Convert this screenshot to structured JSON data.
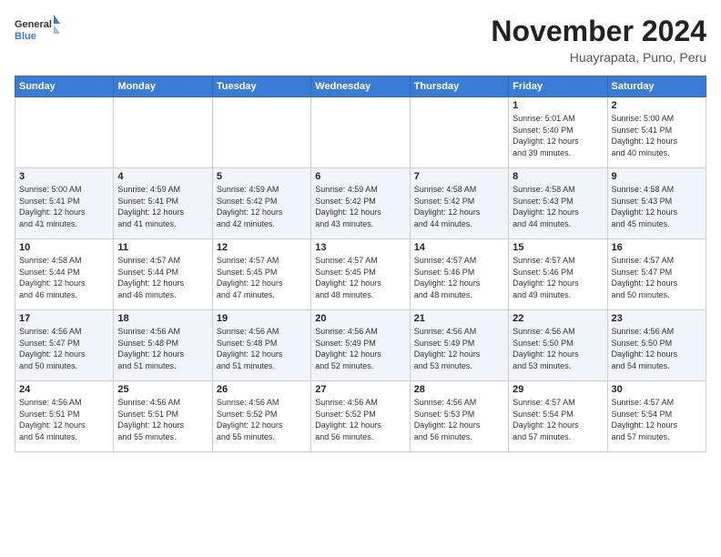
{
  "logo": {
    "general": "General",
    "blue": "Blue"
  },
  "header": {
    "month": "November 2024",
    "location": "Huayrapata, Puno, Peru"
  },
  "weekdays": [
    "Sunday",
    "Monday",
    "Tuesday",
    "Wednesday",
    "Thursday",
    "Friday",
    "Saturday"
  ],
  "weeks": [
    [
      {
        "day": "",
        "info": ""
      },
      {
        "day": "",
        "info": ""
      },
      {
        "day": "",
        "info": ""
      },
      {
        "day": "",
        "info": ""
      },
      {
        "day": "",
        "info": ""
      },
      {
        "day": "1",
        "info": "Sunrise: 5:01 AM\nSunset: 5:40 PM\nDaylight: 12 hours\nand 39 minutes."
      },
      {
        "day": "2",
        "info": "Sunrise: 5:00 AM\nSunset: 5:41 PM\nDaylight: 12 hours\nand 40 minutes."
      }
    ],
    [
      {
        "day": "3",
        "info": "Sunrise: 5:00 AM\nSunset: 5:41 PM\nDaylight: 12 hours\nand 41 minutes."
      },
      {
        "day": "4",
        "info": "Sunrise: 4:59 AM\nSunset: 5:41 PM\nDaylight: 12 hours\nand 41 minutes."
      },
      {
        "day": "5",
        "info": "Sunrise: 4:59 AM\nSunset: 5:42 PM\nDaylight: 12 hours\nand 42 minutes."
      },
      {
        "day": "6",
        "info": "Sunrise: 4:59 AM\nSunset: 5:42 PM\nDaylight: 12 hours\nand 43 minutes."
      },
      {
        "day": "7",
        "info": "Sunrise: 4:58 AM\nSunset: 5:42 PM\nDaylight: 12 hours\nand 44 minutes."
      },
      {
        "day": "8",
        "info": "Sunrise: 4:58 AM\nSunset: 5:43 PM\nDaylight: 12 hours\nand 44 minutes."
      },
      {
        "day": "9",
        "info": "Sunrise: 4:58 AM\nSunset: 5:43 PM\nDaylight: 12 hours\nand 45 minutes."
      }
    ],
    [
      {
        "day": "10",
        "info": "Sunrise: 4:58 AM\nSunset: 5:44 PM\nDaylight: 12 hours\nand 46 minutes."
      },
      {
        "day": "11",
        "info": "Sunrise: 4:57 AM\nSunset: 5:44 PM\nDaylight: 12 hours\nand 46 minutes."
      },
      {
        "day": "12",
        "info": "Sunrise: 4:57 AM\nSunset: 5:45 PM\nDaylight: 12 hours\nand 47 minutes."
      },
      {
        "day": "13",
        "info": "Sunrise: 4:57 AM\nSunset: 5:45 PM\nDaylight: 12 hours\nand 48 minutes."
      },
      {
        "day": "14",
        "info": "Sunrise: 4:57 AM\nSunset: 5:46 PM\nDaylight: 12 hours\nand 48 minutes."
      },
      {
        "day": "15",
        "info": "Sunrise: 4:57 AM\nSunset: 5:46 PM\nDaylight: 12 hours\nand 49 minutes."
      },
      {
        "day": "16",
        "info": "Sunrise: 4:57 AM\nSunset: 5:47 PM\nDaylight: 12 hours\nand 50 minutes."
      }
    ],
    [
      {
        "day": "17",
        "info": "Sunrise: 4:56 AM\nSunset: 5:47 PM\nDaylight: 12 hours\nand 50 minutes."
      },
      {
        "day": "18",
        "info": "Sunrise: 4:56 AM\nSunset: 5:48 PM\nDaylight: 12 hours\nand 51 minutes."
      },
      {
        "day": "19",
        "info": "Sunrise: 4:56 AM\nSunset: 5:48 PM\nDaylight: 12 hours\nand 51 minutes."
      },
      {
        "day": "20",
        "info": "Sunrise: 4:56 AM\nSunset: 5:49 PM\nDaylight: 12 hours\nand 52 minutes."
      },
      {
        "day": "21",
        "info": "Sunrise: 4:56 AM\nSunset: 5:49 PM\nDaylight: 12 hours\nand 53 minutes."
      },
      {
        "day": "22",
        "info": "Sunrise: 4:56 AM\nSunset: 5:50 PM\nDaylight: 12 hours\nand 53 minutes."
      },
      {
        "day": "23",
        "info": "Sunrise: 4:56 AM\nSunset: 5:50 PM\nDaylight: 12 hours\nand 54 minutes."
      }
    ],
    [
      {
        "day": "24",
        "info": "Sunrise: 4:56 AM\nSunset: 5:51 PM\nDaylight: 12 hours\nand 54 minutes."
      },
      {
        "day": "25",
        "info": "Sunrise: 4:56 AM\nSunset: 5:51 PM\nDaylight: 12 hours\nand 55 minutes."
      },
      {
        "day": "26",
        "info": "Sunrise: 4:56 AM\nSunset: 5:52 PM\nDaylight: 12 hours\nand 55 minutes."
      },
      {
        "day": "27",
        "info": "Sunrise: 4:56 AM\nSunset: 5:52 PM\nDaylight: 12 hours\nand 56 minutes."
      },
      {
        "day": "28",
        "info": "Sunrise: 4:56 AM\nSunset: 5:53 PM\nDaylight: 12 hours\nand 56 minutes."
      },
      {
        "day": "29",
        "info": "Sunrise: 4:57 AM\nSunset: 5:54 PM\nDaylight: 12 hours\nand 57 minutes."
      },
      {
        "day": "30",
        "info": "Sunrise: 4:57 AM\nSunset: 5:54 PM\nDaylight: 12 hours\nand 57 minutes."
      }
    ]
  ]
}
